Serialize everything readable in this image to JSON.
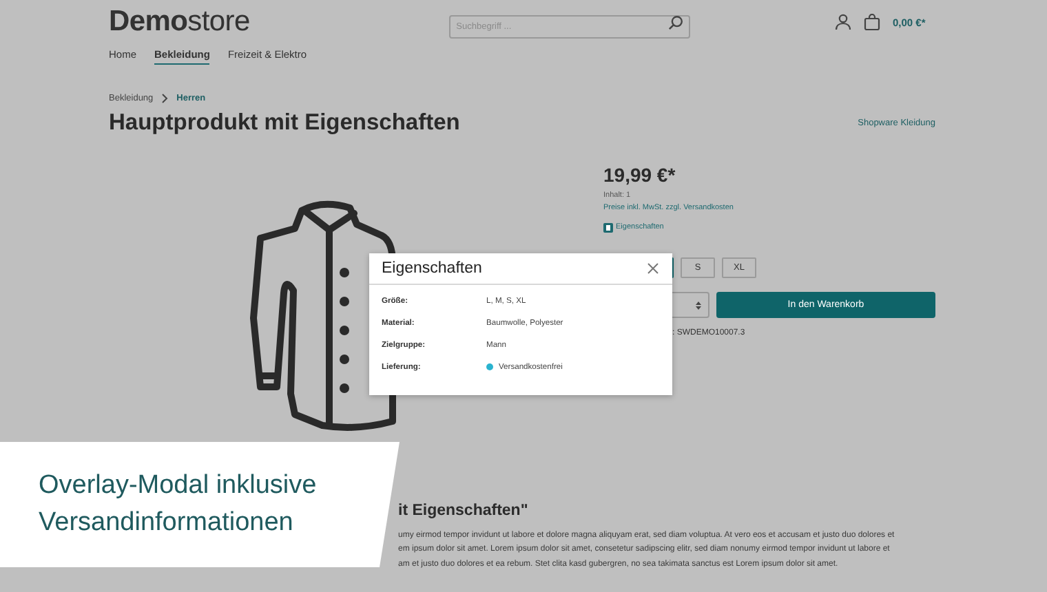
{
  "header": {
    "logo": "**Demo**store",
    "search": {
      "placeholder": "Suchbegriff ..."
    },
    "cart_total": "0,00 €*"
  },
  "nav": [
    {
      "label": "Home",
      "selected": false
    },
    {
      "label": "Bekleidung",
      "selected": true
    },
    {
      "label": "Freizeit & Elektro",
      "selected": false
    }
  ],
  "breadcrumb": [
    {
      "label": "Bekleidung",
      "selected": false
    },
    {
      "label": "Herren",
      "selected": true
    }
  ],
  "product": {
    "title": "Hauptprodukt mit Eigenschaften",
    "manufacturer": "Shopware Kleidung",
    "price": "19,99 €*",
    "content": "Inhalt: 1",
    "tax_note": "Preise inkl. MwSt. zzgl. Versandkosten",
    "properties_link": "Eigenschaften",
    "sizes": [
      {
        "selected": true
      },
      {
        "label": "S",
        "selected": false
      },
      {
        "label": "XL",
        "selected": false
      }
    ],
    "add_to_cart": "In den Warenkorb",
    "product_number": ": SWDEMO10007.3"
  },
  "description": {
    "heading": "it Eigenschaften\"",
    "lines": [
      "umy eirmod tempor invidunt ut labore et dolore magna aliquyam erat, sed diam voluptua. At vero eos et accusam et justo duo dolores et",
      "em ipsum dolor sit amet. Lorem ipsum dolor sit amet, consetetur sadipscing elitr, sed diam nonumy eirmod tempor invidunt ut labore et",
      "am et justo duo dolores et ea rebum. Stet clita kasd gubergren, no sea takimata sanctus est Lorem ipsum dolor sit amet."
    ]
  },
  "modal": {
    "title": "Eigenschaften",
    "rows": [
      {
        "kind": "text",
        "label": "Größe:",
        "value": "L, M, S, XL"
      },
      {
        "kind": "text",
        "label": "Material:",
        "value": "Baumwolle, Polyester"
      },
      {
        "kind": "text",
        "label": "Zielgruppe:",
        "value": "Mann"
      },
      {
        "kind": "status",
        "label": "Lieferung:",
        "value": "Versandkostenfrei",
        "color": "#2ab3cf"
      }
    ]
  },
  "caption": {
    "lines": [
      "Overlay-Modal inklusive",
      "Versandinformationen"
    ]
  }
}
